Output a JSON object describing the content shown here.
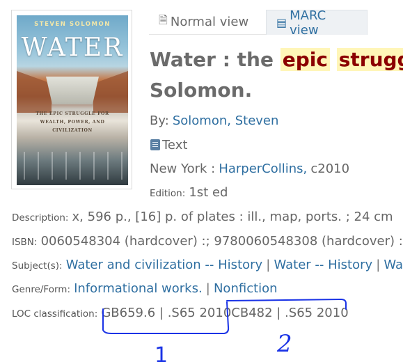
{
  "cover": {
    "author": "STEVEN SOLOMON",
    "title": "WATER",
    "subtitle_lines": [
      "THE EPIC STRUGGLE FOR",
      "WEALTH, POWER, AND",
      "CIVILIZATION"
    ]
  },
  "tabs": {
    "normal": "Normal view",
    "marc": "MARC view"
  },
  "record": {
    "title_prefix": "Water : the ",
    "title_hl1": "epic",
    "title_hl2": "struggle",
    "title_line2": "Solomon.",
    "by_label": "By:",
    "author": "Solomon, Steven",
    "format": "Text",
    "pub_place": "New York :",
    "publisher": "HarperCollins,",
    "pub_year": "c2010",
    "edition_label": "Edition:",
    "edition": "1st ed",
    "description_label": "Description:",
    "description": "x, 596 p., [16] p. of plates : ill., map, ports. ; 24 cm",
    "isbn_label": "ISBN:",
    "isbn": "0060548304 (hardcover) :; 9780060548308 (hardcover) :",
    "subjects_label": "Subject(s):",
    "subjects": [
      "Water and civilization -- History",
      "Water -- History",
      "Wa"
    ],
    "genre_label": "Genre/Form:",
    "genres": [
      "Informational works.",
      "Nonfiction"
    ],
    "loc_label": "LOC classification:",
    "loc_value": "GB659.6 | .S65 2010CB482 | .S65 2010",
    "separator": "|"
  },
  "annotations": {
    "mark1": "1",
    "mark2": "2"
  },
  "colors": {
    "link": "#2f6fa1",
    "highlight_bg": "#fff6b8",
    "highlight_fg": "#8b0000",
    "pen": "#1a33e6"
  }
}
